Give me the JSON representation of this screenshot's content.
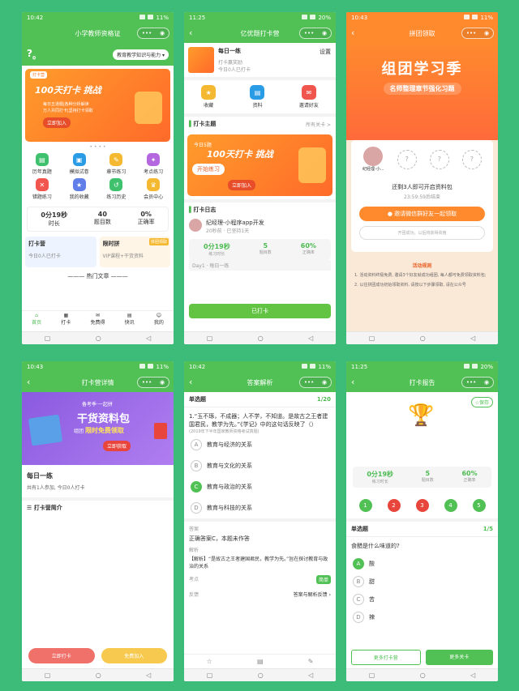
{
  "status": {
    "p1": {
      "time": "10:42",
      "batt": "11%"
    },
    "p2": {
      "time": "11:25",
      "batt": "20%"
    },
    "p3": {
      "time": "10:43",
      "batt": "11%"
    },
    "p4": {
      "time": "10:43",
      "batt": "11%"
    },
    "p5": {
      "time": "10:42",
      "batt": "11%"
    },
    "p6": {
      "time": "11:25",
      "batt": "20%"
    }
  },
  "screen1": {
    "title": "小学教师资格证",
    "dropdown": "教育教学知识与能力",
    "banner_tag": "打卡营",
    "banner_title": "100天打卡 挑战",
    "banner_sub1": "每日五道题|各种分析解读",
    "banner_sub2": "万人共同打卡|坚持打卡领取",
    "banner_btn": "立即加入",
    "grid": [
      {
        "label": "历年真题",
        "color": "#3fc16e"
      },
      {
        "label": "模拟试卷",
        "color": "#2a9ce6"
      },
      {
        "label": "章节练习",
        "color": "#f5b931"
      },
      {
        "label": "考点练习",
        "color": "#b567e0"
      },
      {
        "label": "错题练习",
        "color": "#f0564e"
      },
      {
        "label": "我的收藏",
        "color": "#5f7ee9"
      },
      {
        "label": "练习历史",
        "color": "#3fc16e"
      },
      {
        "label": "会员中心",
        "color": "#f5b931"
      }
    ],
    "stats": [
      {
        "n": "0分19秒",
        "l": "时长"
      },
      {
        "n": "40",
        "l": "题目数"
      },
      {
        "n": "0%",
        "l": "正确率"
      }
    ],
    "card1_title": "打卡营",
    "card1_sub": "今日0人已打卡",
    "card2_title": "限时拼",
    "card2_tag": "拼团领取",
    "card2_sub": "VIP课程+干货资料",
    "hot": "热门文章",
    "tabs": [
      "首页",
      "打卡",
      "免费得",
      "快讯",
      "我的"
    ]
  },
  "screen2": {
    "title": "亿优题打卡营",
    "daily": "每日一练",
    "daily_sub1": "打卡赢奖励",
    "daily_sub2": "今日0人已打卡",
    "setting": "设置",
    "icons": [
      {
        "label": "收藏",
        "color": "#f5b931"
      },
      {
        "label": "资料",
        "color": "#2a9ce6"
      },
      {
        "label": "邀请好友",
        "color": "#f0564e"
      }
    ],
    "theme": "打卡主题",
    "theme_more": "所有关卡 >",
    "banner_title": "100天打卡 挑战",
    "banner_sub": "今日5题",
    "banner_btn1": "开始练习",
    "banner_btn2": "立即加入",
    "log": "打卡日志",
    "user": "纪经理-小程序app开发",
    "user_sub": "20秒前 · 已坚持1天",
    "stats": [
      {
        "n": "0分19秒",
        "l": "练习时长"
      },
      {
        "n": "5",
        "l": "题目数"
      },
      {
        "n": "60%",
        "l": "正确率"
      }
    ],
    "day": "Day1 · 每日一练",
    "btn": "已打卡"
  },
  "screen3": {
    "title": "拼团领取",
    "head1": "组团学习季",
    "head2": "名师整理章节强化习题",
    "user": "纪经理-小...",
    "need": "还剩3人即可开启资料包",
    "countdown": "23:59:59后结束",
    "invite": "邀请微信群好友一起领取",
    "rule_hint": "开团成功，以后将获得资格",
    "rules": "活动规则",
    "rule1": "1. 活动资料终极免费, 邀请3个好友就成功组团, 每人都可免费领取资料包;",
    "rule2": "2. 以往拼团成功初始领取资料, 请按以下步骤领取, 请在公众号"
  },
  "screen4": {
    "title": "打卡营详情",
    "promo_top": "备考季·一起拼",
    "promo_main": "干货资料包",
    "promo_sub1": "组团",
    "promo_sub2": "限时免费领取",
    "promo_btn": "立即获取",
    "daily": "每日一练",
    "daily_sub": "共有1人参加, 今日0人打卡",
    "intro": "打卡营简介",
    "btn1": "立即打卡",
    "btn2": "免费加入"
  },
  "screen5": {
    "title": "答案解析",
    "qtype": "单选题",
    "progress": "1/20",
    "question": "1.“玉不琢，不成器；人不学，不知道。是故古之王者建国君民，教学为先。”《学记》中的这句话反映了（）",
    "source": "(2019年下半年国家教师资格考试真题)",
    "options": [
      {
        "k": "A",
        "t": "教育与经济的关系",
        "sel": false
      },
      {
        "k": "B",
        "t": "教育与文化的关系",
        "sel": false
      },
      {
        "k": "C",
        "t": "教育与政治的关系",
        "sel": true
      },
      {
        "k": "D",
        "t": "教育与科技的关系",
        "sel": false
      }
    ],
    "answer_h": "答案",
    "answer": "正确答案C，本题未作答",
    "analysis_h": "解析",
    "analysis": "【解析】“是故古之王者建国君民，教学为先。”旨在探讨教育与政治的关系",
    "point": "考点",
    "point_tag": "简单",
    "feedback": "反馈",
    "feedback_link": "答案与解析反馈"
  },
  "screen6": {
    "title": "打卡报告",
    "save": "保存",
    "stats": [
      {
        "n": "0分19秒",
        "l": "练习时长"
      },
      {
        "n": "5",
        "l": "题目数"
      },
      {
        "n": "60%",
        "l": "正确率"
      }
    ],
    "nums": [
      {
        "n": "1",
        "c": "#52c155"
      },
      {
        "n": "2",
        "c": "#e8463c"
      },
      {
        "n": "3",
        "c": "#e8463c"
      },
      {
        "n": "4",
        "c": "#52c155"
      },
      {
        "n": "5",
        "c": "#52c155"
      }
    ],
    "qtype": "单选题",
    "progress": "1/5",
    "question": "食醋是什么味道的?",
    "options": [
      {
        "k": "A",
        "t": "酸",
        "sel": true
      },
      {
        "k": "B",
        "t": "甜",
        "sel": false
      },
      {
        "k": "C",
        "t": "苦",
        "sel": false
      },
      {
        "k": "D",
        "t": "辣",
        "sel": false
      }
    ],
    "btn1": "更多打卡营",
    "btn2": "更多关卡"
  }
}
